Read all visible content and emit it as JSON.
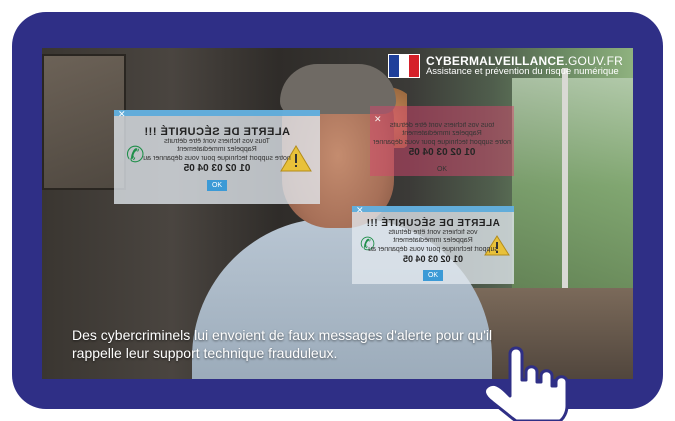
{
  "logo": {
    "title_bold": "CYBERMALVEILLANCE",
    "title_light": ".GOUV.FR",
    "subtitle": "Assistance et prévention du risque numérique"
  },
  "popups": [
    {
      "close": "✕",
      "title": "ALERTE DE SÉCURITÉ !!!",
      "lines": [
        "Tous vos fichiers vont être détruits",
        "Rappelez immédiatement",
        "notre support technique pour vous dépanner au"
      ],
      "phone": "01 02 03 04 05",
      "ok": "OK"
    },
    {
      "close": "✕",
      "lines": [
        "tous vos fichiers vont être détruits",
        "Rappelez immédiatement",
        "notre support technique pour vous dépanner"
      ],
      "phone": "01 02 03 04 05",
      "ok": "OK"
    },
    {
      "close": "✕",
      "title": "ALERTE DE SÉCURITÉ !!!",
      "lines": [
        "vos fichiers vont être détruits",
        "Rappelez immédiatement",
        "support technique pour vous dépanner au"
      ],
      "phone": "01 02 03 04 05",
      "ok": "OK"
    }
  ],
  "subtitle": {
    "line1": "Des cybercriminels lui envoient de faux messages d'alerte pour qu'il",
    "line2": "rappelle leur support technique frauduleux."
  },
  "icons": [
    "phone-icon",
    "warning-icon",
    "pointer-hand-icon",
    "french-flag-icon"
  ],
  "colors": {
    "frame": "#2f2f86",
    "popup_bar": "#58aadc",
    "phone": "#1f8f4a",
    "warning": "#e8c13a"
  }
}
